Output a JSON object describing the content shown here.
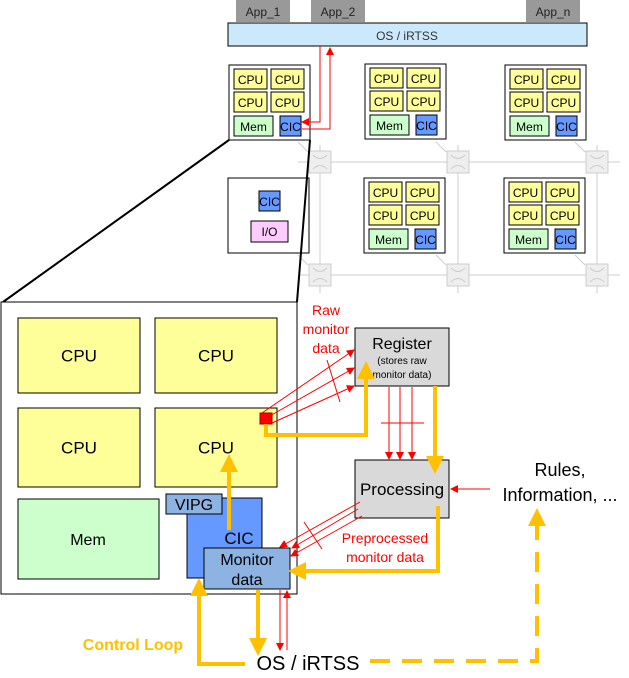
{
  "apps": [
    "App_1",
    "App_2",
    "App_n"
  ],
  "os_bar": "OS / iRTSS",
  "tile": {
    "cpu": "CPU",
    "mem": "Mem",
    "cic": "CIC",
    "io": "I/O"
  },
  "detail": {
    "cpu": "CPU",
    "mem": "Mem",
    "cic": "CIC",
    "vipg": "VIPG",
    "monitor1": "Monitor",
    "monitor2": "data"
  },
  "register": {
    "title": "Register",
    "sub1": "(stores raw",
    "sub2": "monitor data)"
  },
  "processing": "Processing",
  "raw": [
    "Raw",
    "monitor",
    "data"
  ],
  "pre": [
    "Preprocessed",
    "monitor data"
  ],
  "rules": [
    "Rules,",
    "Information, ..."
  ],
  "os_bottom": "OS / iRTSS",
  "control_loop": "Control Loop",
  "colors": {
    "cpu": "#ffff99",
    "mem": "#ccffcc",
    "cic": "#6699ff",
    "monitor": "#8db3e2",
    "io": "#ffccff",
    "os": "#cce9fb",
    "app": "#999999",
    "loop": "#ffc000",
    "signal": "#ff0000",
    "box": "#d9d9d9"
  }
}
